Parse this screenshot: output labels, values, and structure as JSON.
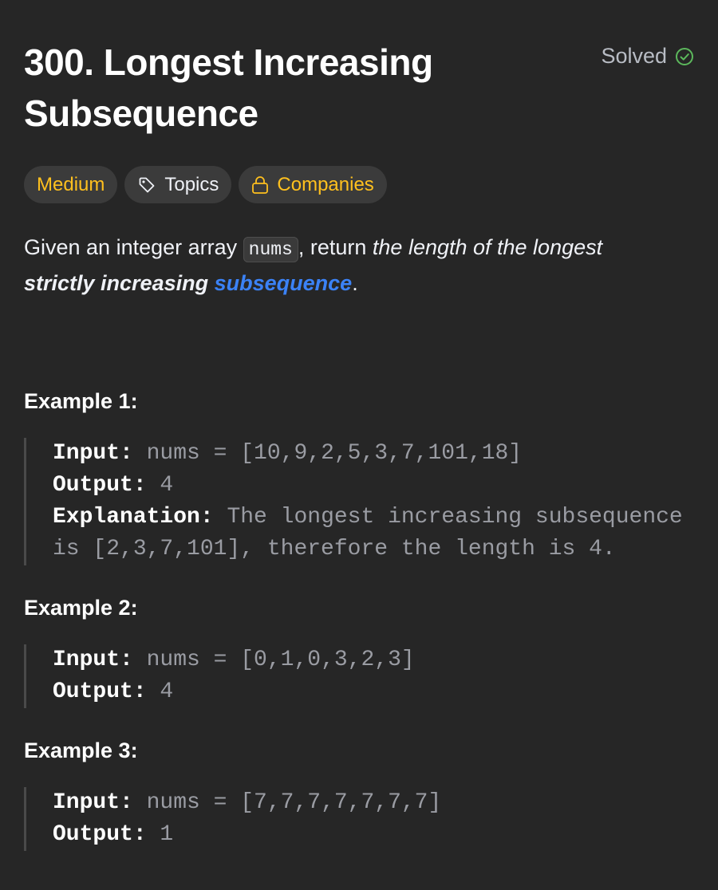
{
  "problem": {
    "title": "300. Longest Increasing Subsequence",
    "status_label": "Solved",
    "status_icon": "check-circle-icon",
    "status_color": "#5cb85c"
  },
  "tags": {
    "difficulty": "Medium",
    "topics": "Topics",
    "companies": "Companies",
    "difficulty_color": "#ffc01e"
  },
  "description": {
    "part1": "Given an integer array ",
    "code": "nums",
    "part2": ", return ",
    "emph1": "the length of the longest",
    "emph2": "strictly increasing",
    "link": "subsequence",
    "period": ".",
    "link_color": "#3b82f6"
  },
  "examples": [
    {
      "title": "Example 1:",
      "input_label": "Input:",
      "input_value": " nums = [10,9,2,5,3,7,101,18]",
      "output_label": "Output:",
      "output_value": " 4",
      "explanation_label": "Explanation:",
      "explanation_line1": " The longest increasing subsequence",
      "explanation_line2": "is [2,3,7,101], therefore the length is 4."
    },
    {
      "title": "Example 2:",
      "input_label": "Input:",
      "input_value": " nums = [0,1,0,3,2,3]",
      "output_label": "Output:",
      "output_value": " 4"
    },
    {
      "title": "Example 3:",
      "input_label": "Input:",
      "input_value": " nums = [7,7,7,7,7,7,7]",
      "output_label": "Output:",
      "output_value": " 1"
    }
  ]
}
